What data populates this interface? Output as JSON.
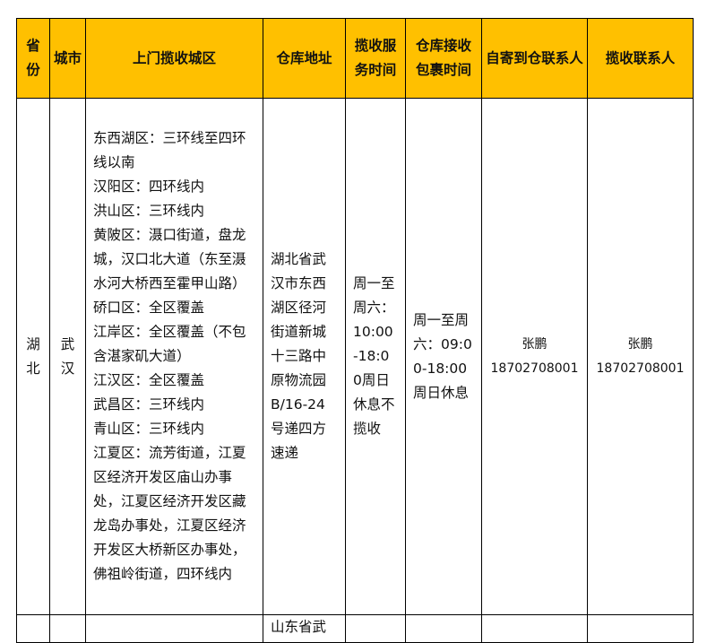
{
  "headers": [
    "省份",
    "城市",
    "上门揽收城区",
    "仓库地址",
    "揽收服务时间",
    "仓库接收包裹时间",
    "自寄到仓联系人",
    "揽收联系人"
  ],
  "rows": [
    {
      "province": "湖北",
      "city": "武汉",
      "areas": "东西湖区：三环线至四环线以南\n汉阳区：四环线内\n洪山区：三环线内\n黄陂区：滠口街道，盘龙城，汉口北大道（东至滠水河大桥西至霍甲山路）\n硚口区：全区覆盖\n江岸区：全区覆盖（不包含湛家矶大道）\n江汉区：全区覆盖\n武昌区：三环线内\n青山区：三环线内\n江夏区：流芳街道，江夏区经济开发区庙山办事处，江夏区经济开发区藏龙岛办事处，江夏区经济开发区大桥新区办事处，佛祖岭街道，四环线内",
      "warehouse_address": "湖北省武汉市东西湖区径河街道新城十三路中原物流园B/16-24号递四方速递",
      "pickup_hours": "周一至周六：10:00-18:00周日休息不揽收",
      "receive_hours": "周一至周六：09:00-18:00周日休息",
      "self_delivery_contact": "张鹏\n18702708001",
      "pickup_contact": "张鹏\n18702708001"
    },
    {
      "warehouse_address": "山东省武"
    }
  ]
}
